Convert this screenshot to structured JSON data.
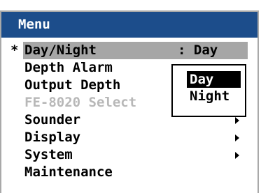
{
  "menu": {
    "title": "Menu",
    "selected_marker": "*",
    "items": [
      {
        "label": "Day/Night",
        "value": ": Day"
      },
      {
        "label": "Depth Alarm"
      },
      {
        "label": "Output Depth"
      },
      {
        "label": "FE-8020 Select"
      },
      {
        "label": "Sounder"
      },
      {
        "label": "Display"
      },
      {
        "label": "System"
      },
      {
        "label": "Maintenance"
      }
    ]
  },
  "popup": {
    "options": [
      "Day",
      "Night"
    ],
    "selected": "Day"
  },
  "colors": {
    "title_bar": "#1c4d8b",
    "selection": "#a6a6a6",
    "disabled_text": "#b8b8b8"
  },
  "icons": {
    "submenu_arrow": "triangle-right"
  }
}
